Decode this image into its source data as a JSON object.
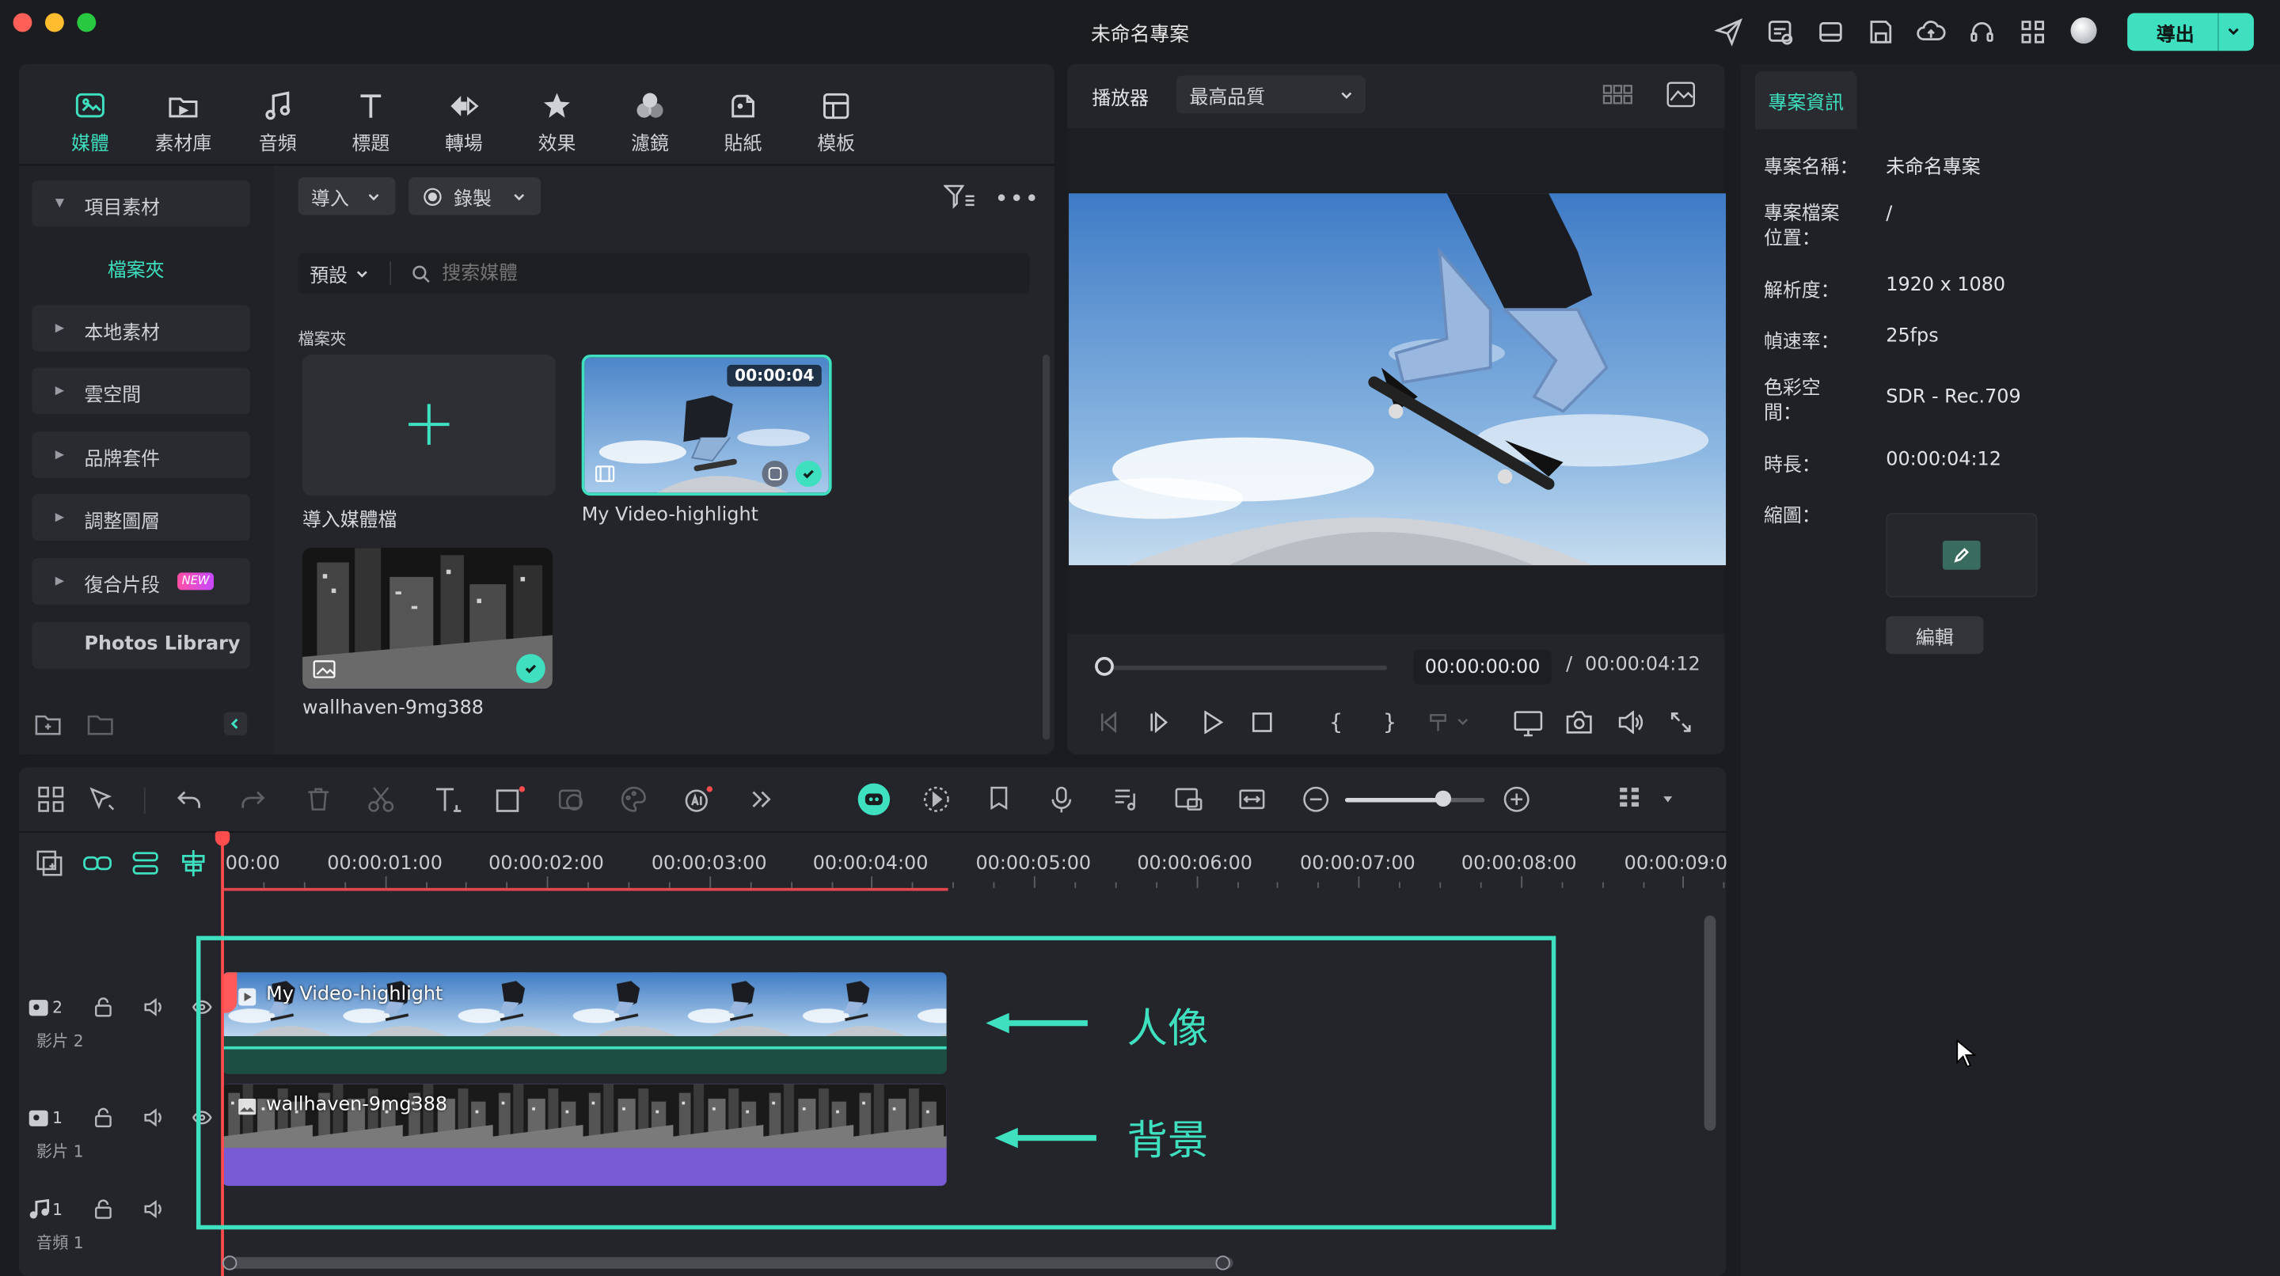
{
  "app": {
    "window_title": "未命名專案",
    "export_label": "導出"
  },
  "library": {
    "tabs": [
      {
        "label": "媒體",
        "icon": "media-icon",
        "active": true
      },
      {
        "label": "素材庫",
        "icon": "stock-icon"
      },
      {
        "label": "音頻",
        "icon": "music-note-icon"
      },
      {
        "label": "標題",
        "icon": "title-t-icon"
      },
      {
        "label": "轉場",
        "icon": "transition-icon"
      },
      {
        "label": "效果",
        "icon": "effects-star-icon"
      },
      {
        "label": "濾鏡",
        "icon": "filters-icon"
      },
      {
        "label": "貼紙",
        "icon": "sticker-icon"
      },
      {
        "label": "模板",
        "icon": "template-icon"
      }
    ],
    "sidebar": {
      "project_media": "項目素材",
      "folder": "檔案夾",
      "items": [
        "本地素材",
        "雲空間",
        "品牌套件",
        "調整圖層",
        "復合片段"
      ],
      "new_badge": "NEW",
      "photos_library": "Photos Library"
    },
    "toolbar": {
      "import_label": "導入",
      "record_label": "錄製",
      "preset_label": "預設",
      "search_placeholder": "搜索媒體"
    },
    "section_label": "檔案夾",
    "media": [
      {
        "name": "導入媒體檔"
      },
      {
        "name": "My Video-highlight",
        "duration": "00:00:04"
      },
      {
        "name": "wallhaven-9mg388"
      }
    ]
  },
  "player": {
    "label": "播放器",
    "quality": "最高品質",
    "current_time": "00:00:00:00",
    "separator": "/",
    "total_time": "00:00:04:12"
  },
  "info": {
    "tab_label": "專案資訊",
    "rows": [
      {
        "label": "專案名稱：",
        "value": "未命名專案"
      },
      {
        "label": "專案檔案位置：",
        "value": "/"
      },
      {
        "label": "解析度：",
        "value": "1920 x 1080"
      },
      {
        "label": "幀速率：",
        "value": "25fps"
      },
      {
        "label": "色彩空間：",
        "value": "SDR - Rec.709"
      },
      {
        "label": "時長：",
        "value": "00:00:04:12"
      },
      {
        "label": "縮圖：",
        "value": ""
      }
    ],
    "edit_label": "編輯"
  },
  "timeline": {
    "ruler": [
      "00:00",
      "00:00:01:00",
      "00:00:02:00",
      "00:00:03:00",
      "00:00:04:00",
      "00:00:05:00",
      "00:00:06:00",
      "00:00:07:00",
      "00:00:08:00",
      "00:00:09:0"
    ],
    "tracks": [
      {
        "num": "2",
        "name": "影片 2"
      },
      {
        "num": "1",
        "name": "影片 1"
      },
      {
        "num": "1",
        "name": "音頻 1"
      }
    ],
    "clips": [
      {
        "name": "My Video-highlight"
      },
      {
        "name": "wallhaven-9mg388"
      }
    ],
    "annotations": [
      {
        "text": "人像"
      },
      {
        "text": "背景"
      }
    ]
  },
  "colors": {
    "accent": "#3ee0c0",
    "playhead": "#ff4d4d",
    "bg_clip": "#7a5bd6",
    "panel": "#24252a"
  }
}
